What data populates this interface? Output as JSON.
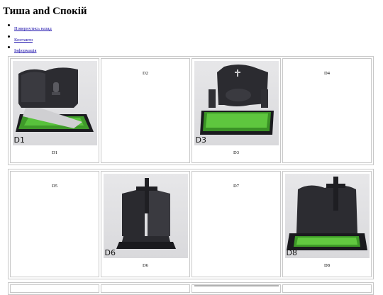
{
  "page": {
    "title": "Тиша and Спокій"
  },
  "nav": [
    {
      "label": "Повернутись назад"
    },
    {
      "label": "Контакти"
    },
    {
      "label": "Інформація"
    }
  ],
  "grid": {
    "row1": [
      {
        "code": "D1",
        "caption": "D1",
        "has_image": true
      },
      {
        "code": "",
        "caption": "D2",
        "has_image": false
      },
      {
        "code": "D3",
        "caption": "D3",
        "has_image": true
      },
      {
        "code": "",
        "caption": "D4",
        "has_image": false
      }
    ],
    "row2": [
      {
        "code": "",
        "caption": "D5",
        "has_image": false
      },
      {
        "code": "D6",
        "caption": "D6",
        "has_image": true
      },
      {
        "code": "",
        "caption": "D7",
        "has_image": false
      },
      {
        "code": "D8",
        "caption": "D8",
        "has_image": true
      }
    ]
  }
}
